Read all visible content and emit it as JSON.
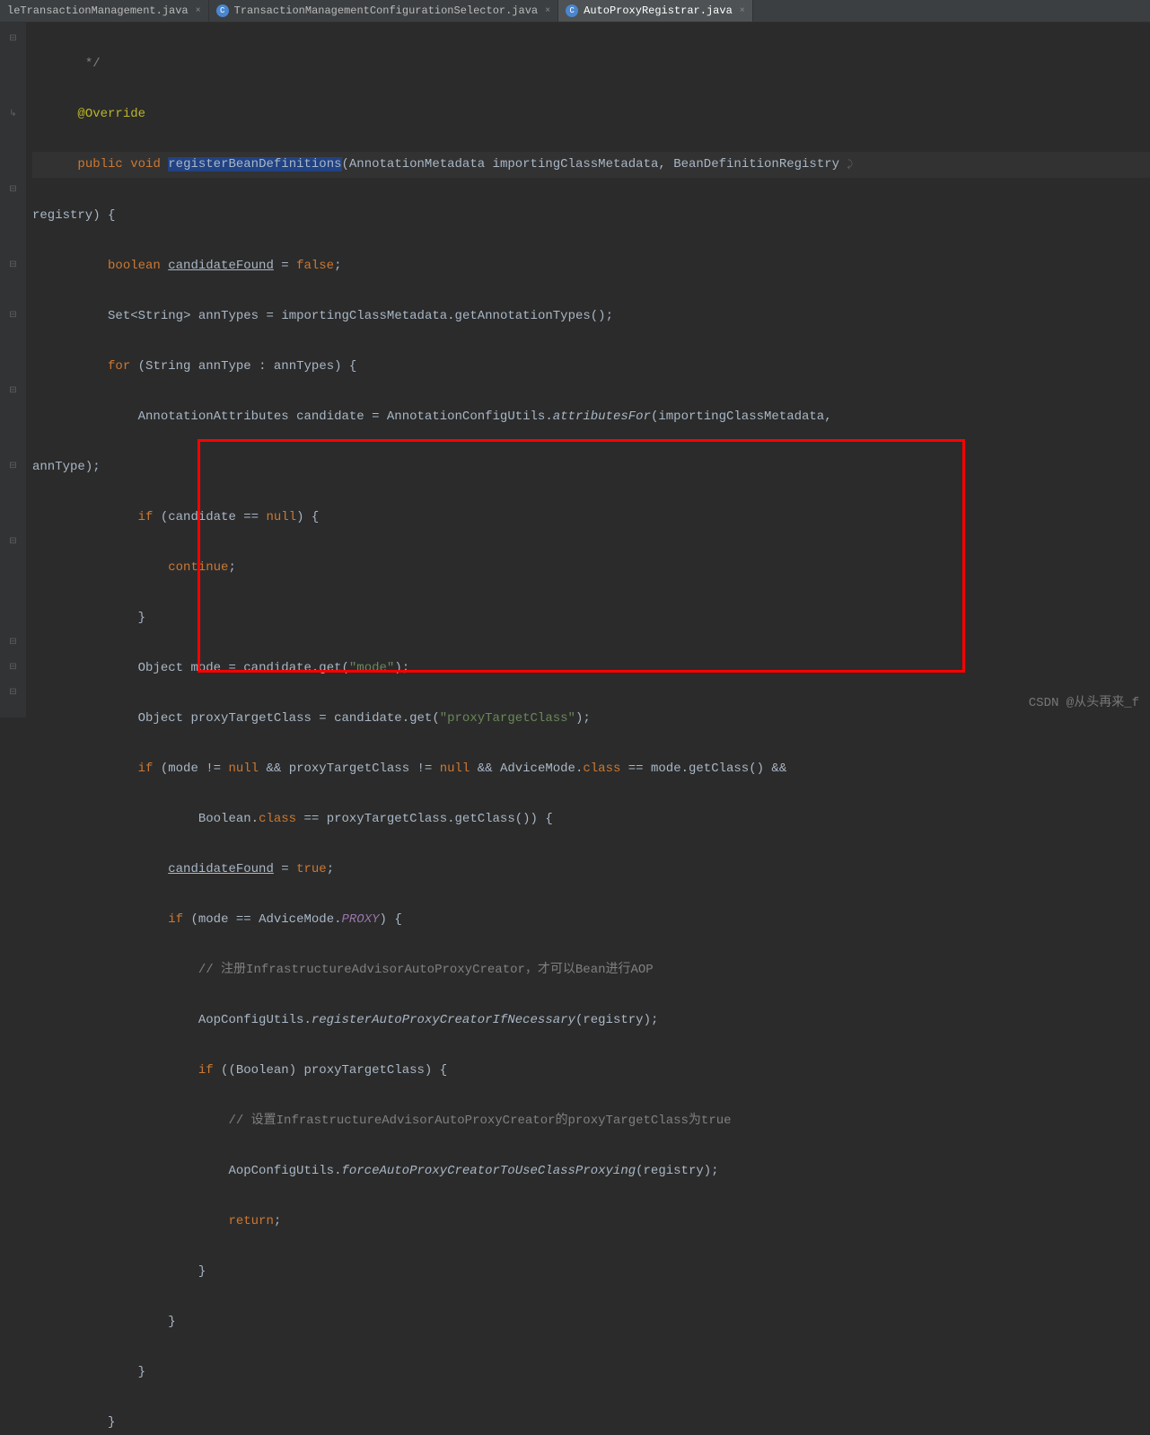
{
  "tabs": [
    {
      "label": "leTransactionManagement.java",
      "active": false
    },
    {
      "label": "TransactionManagementConfigurationSelector.java",
      "active": false
    },
    {
      "label": "AutoProxyRegistrar.java",
      "active": true
    }
  ],
  "code": {
    "l1": "*/",
    "l2_ann": "@Override",
    "l3_public": "public",
    "l3_void": "void",
    "l3_method": "registerBeanDefinitions",
    "l3_param1_type": "AnnotationMetadata",
    "l3_param1_name": "importingClassMetadata",
    "l3_param2_type": "BeanDefinitionRegistry",
    "l4_param": "registry",
    "l5_boolean": "boolean",
    "l5_var": "candidateFound",
    "l5_val": "false",
    "l6_type": "Set",
    "l6_generic": "String",
    "l6_var": "annTypes",
    "l6_call": "importingClassMetadata.getAnnotationTypes()",
    "l7_for": "for",
    "l7_type": "String",
    "l7_var": "annType",
    "l7_iter": "annTypes",
    "l8_type": "AnnotationAttributes",
    "l8_var": "candidate",
    "l8_class": "AnnotationConfigUtils",
    "l8_method": "attributesFor",
    "l8_arg1": "importingClassMetadata",
    "l9_arg2": "annType",
    "l10_if": "if",
    "l10_cond": "candidate",
    "l10_null": "null",
    "l11_continue": "continue",
    "l13_type": "Object",
    "l13_var": "mode",
    "l13_expr": "candidate.get",
    "l13_str": "\"mode\"",
    "l14_type": "Object",
    "l14_var": "proxyTargetClass",
    "l14_expr": "candidate.get",
    "l14_str": "\"proxyTargetClass\"",
    "l15_if": "if",
    "l15_var1": "mode",
    "l15_null": "null",
    "l15_var2": "proxyTargetClass",
    "l15_class": "AdviceMode",
    "l15_cls": "class",
    "l15_call": "mode.getClass()",
    "l16_class": "Boolean",
    "l16_cls": "class",
    "l16_call": "proxyTargetClass.getClass()",
    "l17_var": "candidateFound",
    "l17_val": "true",
    "l18_if": "if",
    "l18_var": "mode",
    "l18_class": "AdviceMode",
    "l18_const": "PROXY",
    "l19_cmt": "// 注册InfrastructureAdvisorAutoProxyCreator，才可以Bean进行AOP",
    "l20_class": "AopConfigUtils",
    "l20_method": "registerAutoProxyCreatorIfNecessary",
    "l20_arg": "registry",
    "l21_if": "if",
    "l21_cast": "Boolean",
    "l21_var": "proxyTargetClass",
    "l22_cmt": "// 设置InfrastructureAdvisorAutoProxyCreator的proxyTargetClass为true",
    "l23_class": "AopConfigUtils",
    "l23_method": "forceAutoProxyCreatorToUseClassProxying",
    "l23_arg": "registry",
    "l24_return": "return"
  },
  "watermark": "CSDN @从头再来_f"
}
